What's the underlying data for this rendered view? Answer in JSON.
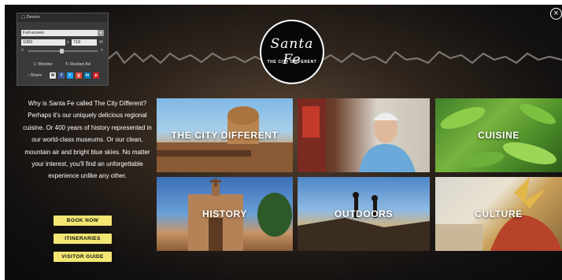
{
  "logo": {
    "script": "Santa Fe",
    "tagline": "THE CITY DIFFERENT"
  },
  "close": {
    "glyph": "×",
    "icon": "close-icon"
  },
  "intro": {
    "text": "Why is Santa Fe called The City Different? Perhaps it's our uniquely delicious regional cuisine. Or 400 years of history represented in our world-class museums. Or our clean, mountain air and bright blue skies. No matter your interest, you'll find an unforgettable experience unlike any other."
  },
  "buttons": {
    "book_now": "BOOK NOW",
    "itineraries": "ITINERARIES",
    "visitor_guide": "VISITOR GUIDE"
  },
  "tiles": {
    "city_different": "THE CITY DIFFERENT",
    "video_caption": "",
    "cuisine": "CUISINE",
    "history": "HISTORY",
    "outdoors": "OUTDOORS",
    "culture": "CULTURE"
  },
  "device_panel": {
    "title": "Device",
    "mode": "Full-screen",
    "width": "1083",
    "x": "x",
    "height": "718",
    "monitor": "Monitor",
    "restart": "Restart Ad",
    "share": "Share"
  },
  "colors": {
    "accent": "#f3e673",
    "background": "#1a1512"
  }
}
